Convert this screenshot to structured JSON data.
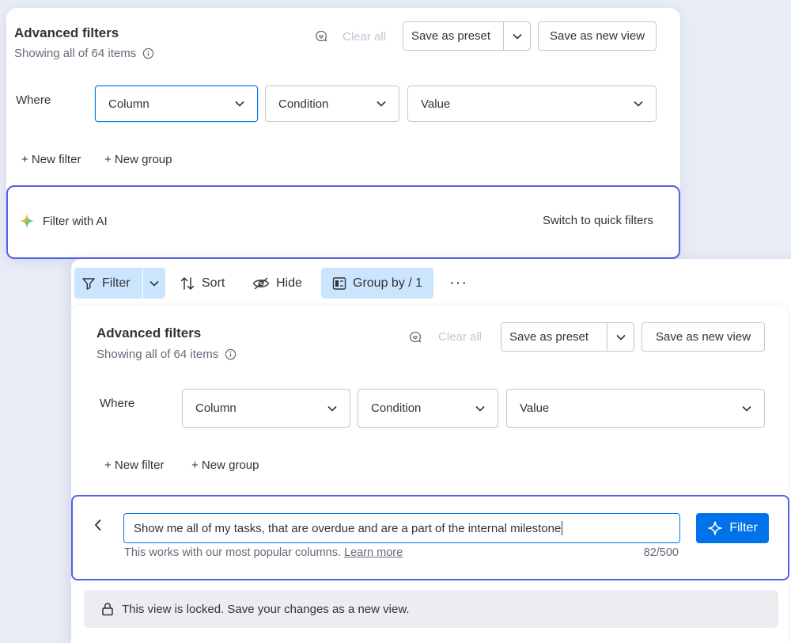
{
  "panel_top": {
    "title": "Advanced filters",
    "subtitle": "Showing all of 64 items",
    "clear_all": "Clear all",
    "save_preset": "Save as preset",
    "save_new_view": "Save as new view",
    "where": "Where",
    "column": "Column",
    "condition": "Condition",
    "value": "Value",
    "new_filter": "+ New filter",
    "new_group": "+ New group",
    "filter_with_ai": "Filter with AI",
    "switch_quick": "Switch to quick filters"
  },
  "toolbar": {
    "filter": "Filter",
    "sort": "Sort",
    "hide": "Hide",
    "group_by": "Group by / 1",
    "more": "···"
  },
  "panel_bottom": {
    "title": "Advanced filters",
    "subtitle": "Showing all of 64 items",
    "clear_all": "Clear all",
    "save_preset": "Save as preset",
    "save_new_view": "Save as new view",
    "where": "Where",
    "column": "Column",
    "condition": "Condition",
    "value": "Value",
    "new_filter": "+ New filter",
    "new_group": "+ New group",
    "ai_query": "Show me all of my tasks, that are overdue and are a part of the internal milestone",
    "ai_hint": "This works with our most popular columns.",
    "learn_more": "Learn more",
    "char_count": "82/500",
    "filter_button": "Filter",
    "locked_notice": "This view is locked. Save your changes as a new view."
  },
  "colors": {
    "primary": "#0073ea",
    "ai_border": "#5560e6",
    "toolbar_active": "#cce5ff"
  }
}
